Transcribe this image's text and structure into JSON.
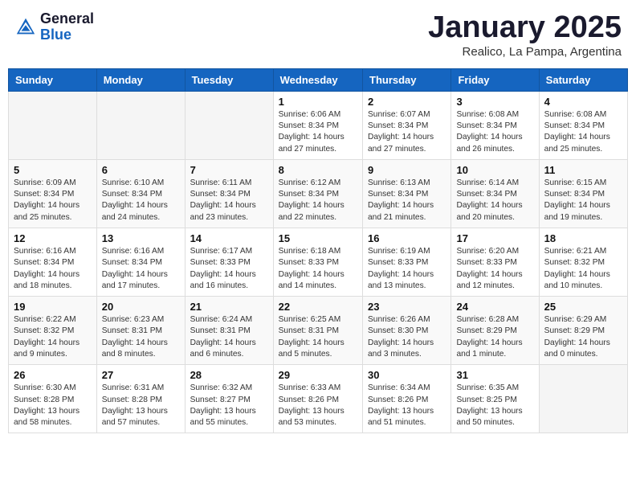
{
  "header": {
    "logo_general": "General",
    "logo_blue": "Blue",
    "month_title": "January 2025",
    "subtitle": "Realico, La Pampa, Argentina"
  },
  "days_of_week": [
    "Sunday",
    "Monday",
    "Tuesday",
    "Wednesday",
    "Thursday",
    "Friday",
    "Saturday"
  ],
  "weeks": [
    [
      {
        "day": "",
        "info": ""
      },
      {
        "day": "",
        "info": ""
      },
      {
        "day": "",
        "info": ""
      },
      {
        "day": "1",
        "info": "Sunrise: 6:06 AM\nSunset: 8:34 PM\nDaylight: 14 hours\nand 27 minutes."
      },
      {
        "day": "2",
        "info": "Sunrise: 6:07 AM\nSunset: 8:34 PM\nDaylight: 14 hours\nand 27 minutes."
      },
      {
        "day": "3",
        "info": "Sunrise: 6:08 AM\nSunset: 8:34 PM\nDaylight: 14 hours\nand 26 minutes."
      },
      {
        "day": "4",
        "info": "Sunrise: 6:08 AM\nSunset: 8:34 PM\nDaylight: 14 hours\nand 25 minutes."
      }
    ],
    [
      {
        "day": "5",
        "info": "Sunrise: 6:09 AM\nSunset: 8:34 PM\nDaylight: 14 hours\nand 25 minutes."
      },
      {
        "day": "6",
        "info": "Sunrise: 6:10 AM\nSunset: 8:34 PM\nDaylight: 14 hours\nand 24 minutes."
      },
      {
        "day": "7",
        "info": "Sunrise: 6:11 AM\nSunset: 8:34 PM\nDaylight: 14 hours\nand 23 minutes."
      },
      {
        "day": "8",
        "info": "Sunrise: 6:12 AM\nSunset: 8:34 PM\nDaylight: 14 hours\nand 22 minutes."
      },
      {
        "day": "9",
        "info": "Sunrise: 6:13 AM\nSunset: 8:34 PM\nDaylight: 14 hours\nand 21 minutes."
      },
      {
        "day": "10",
        "info": "Sunrise: 6:14 AM\nSunset: 8:34 PM\nDaylight: 14 hours\nand 20 minutes."
      },
      {
        "day": "11",
        "info": "Sunrise: 6:15 AM\nSunset: 8:34 PM\nDaylight: 14 hours\nand 19 minutes."
      }
    ],
    [
      {
        "day": "12",
        "info": "Sunrise: 6:16 AM\nSunset: 8:34 PM\nDaylight: 14 hours\nand 18 minutes."
      },
      {
        "day": "13",
        "info": "Sunrise: 6:16 AM\nSunset: 8:34 PM\nDaylight: 14 hours\nand 17 minutes."
      },
      {
        "day": "14",
        "info": "Sunrise: 6:17 AM\nSunset: 8:33 PM\nDaylight: 14 hours\nand 16 minutes."
      },
      {
        "day": "15",
        "info": "Sunrise: 6:18 AM\nSunset: 8:33 PM\nDaylight: 14 hours\nand 14 minutes."
      },
      {
        "day": "16",
        "info": "Sunrise: 6:19 AM\nSunset: 8:33 PM\nDaylight: 14 hours\nand 13 minutes."
      },
      {
        "day": "17",
        "info": "Sunrise: 6:20 AM\nSunset: 8:33 PM\nDaylight: 14 hours\nand 12 minutes."
      },
      {
        "day": "18",
        "info": "Sunrise: 6:21 AM\nSunset: 8:32 PM\nDaylight: 14 hours\nand 10 minutes."
      }
    ],
    [
      {
        "day": "19",
        "info": "Sunrise: 6:22 AM\nSunset: 8:32 PM\nDaylight: 14 hours\nand 9 minutes."
      },
      {
        "day": "20",
        "info": "Sunrise: 6:23 AM\nSunset: 8:31 PM\nDaylight: 14 hours\nand 8 minutes."
      },
      {
        "day": "21",
        "info": "Sunrise: 6:24 AM\nSunset: 8:31 PM\nDaylight: 14 hours\nand 6 minutes."
      },
      {
        "day": "22",
        "info": "Sunrise: 6:25 AM\nSunset: 8:31 PM\nDaylight: 14 hours\nand 5 minutes."
      },
      {
        "day": "23",
        "info": "Sunrise: 6:26 AM\nSunset: 8:30 PM\nDaylight: 14 hours\nand 3 minutes."
      },
      {
        "day": "24",
        "info": "Sunrise: 6:28 AM\nSunset: 8:29 PM\nDaylight: 14 hours\nand 1 minute."
      },
      {
        "day": "25",
        "info": "Sunrise: 6:29 AM\nSunset: 8:29 PM\nDaylight: 14 hours\nand 0 minutes."
      }
    ],
    [
      {
        "day": "26",
        "info": "Sunrise: 6:30 AM\nSunset: 8:28 PM\nDaylight: 13 hours\nand 58 minutes."
      },
      {
        "day": "27",
        "info": "Sunrise: 6:31 AM\nSunset: 8:28 PM\nDaylight: 13 hours\nand 57 minutes."
      },
      {
        "day": "28",
        "info": "Sunrise: 6:32 AM\nSunset: 8:27 PM\nDaylight: 13 hours\nand 55 minutes."
      },
      {
        "day": "29",
        "info": "Sunrise: 6:33 AM\nSunset: 8:26 PM\nDaylight: 13 hours\nand 53 minutes."
      },
      {
        "day": "30",
        "info": "Sunrise: 6:34 AM\nSunset: 8:26 PM\nDaylight: 13 hours\nand 51 minutes."
      },
      {
        "day": "31",
        "info": "Sunrise: 6:35 AM\nSunset: 8:25 PM\nDaylight: 13 hours\nand 50 minutes."
      },
      {
        "day": "",
        "info": ""
      }
    ]
  ]
}
